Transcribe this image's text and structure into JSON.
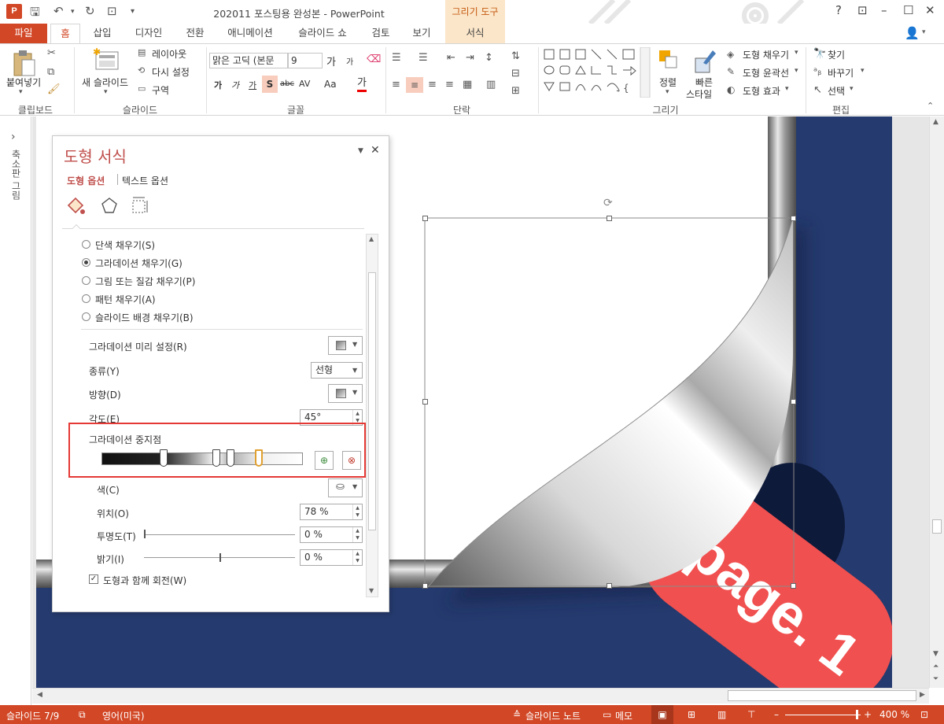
{
  "titlebar": {
    "title": "202011 포스팅용 완성본 - PowerPoint",
    "contextual_group": "그리기 도구",
    "help": "?"
  },
  "tabs": [
    {
      "label": "파일"
    },
    {
      "label": "홈"
    },
    {
      "label": "삽입"
    },
    {
      "label": "디자인"
    },
    {
      "label": "전환"
    },
    {
      "label": "애니메이션"
    },
    {
      "label": "슬라이드 쇼"
    },
    {
      "label": "검토"
    },
    {
      "label": "보기"
    },
    {
      "label": "서식"
    }
  ],
  "ribbon": {
    "clipboard": {
      "paste": "붙여넣기",
      "label": "클립보드"
    },
    "slides": {
      "new_slide": "새 슬라이드",
      "layout": "레이아웃",
      "reset": "다시 설정",
      "section": "구역",
      "label": "슬라이드"
    },
    "font": {
      "font_name": "맑은 고딕 (본문",
      "font_size": "9",
      "label": "글꼴",
      "grow": "가",
      "shrink": "가",
      "bold": "가",
      "italic": "가",
      "underline": "가",
      "shadow": "S",
      "strike": "abc",
      "spacing": "AV",
      "case": "Aa",
      "color": "가"
    },
    "paragraph": {
      "label": "단락"
    },
    "drawing": {
      "arrange": "정렬",
      "quick_styles_1": "빠른",
      "quick_styles_2": "스타일",
      "shape_fill": "도형 채우기",
      "shape_outline": "도형 윤곽선",
      "shape_effects": "도형 효과",
      "label": "그리기"
    },
    "editing": {
      "find": "찾기",
      "replace": "바꾸기",
      "select": "선택",
      "label": "편집"
    }
  },
  "left_strip": {
    "label": "축소판 그림",
    "expand": "›"
  },
  "pane": {
    "title": "도형 서식",
    "tab_shape": "도형 옵션",
    "tab_text": "텍스트 옵션",
    "fill_options": [
      {
        "label": "단색 채우기(S)",
        "selected": false
      },
      {
        "label": "그라데이션 채우기(G)",
        "selected": true
      },
      {
        "label": "그림 또는 질감 채우기(P)",
        "selected": false
      },
      {
        "label": "패턴 채우기(A)",
        "selected": false
      },
      {
        "label": "슬라이드 배경 채우기(B)",
        "selected": false
      }
    ],
    "preset_label": "그라데이션 미리 설정(R)",
    "type_label": "종류(Y)",
    "type_value": "선형",
    "direction_label": "방향(D)",
    "angle_label": "각도(E)",
    "angle_value": "45°",
    "stops_label": "그라데이션 중지점",
    "gradient_stops": [
      0.31,
      0.57,
      0.64,
      0.78
    ],
    "selected_stop": 0.78,
    "color_label": "색(C)",
    "position_label": "위치(O)",
    "position_value": "78 %",
    "transparency_label": "투명도(T)",
    "transparency_value": "0 %",
    "transparency_level": 0,
    "brightness_label": "밝기(I)",
    "brightness_value": "0 %",
    "brightness_level": 0.5,
    "rotate_with_shape": "도형과 함께 회전(W)",
    "rotate_checked": true
  },
  "slide": {
    "tab_text": "page. 1",
    "colors": {
      "navy": "#253a6e",
      "coral": "#f0504f",
      "highlight": "#e53935"
    }
  },
  "status": {
    "slide_info": "슬라이드 7/9",
    "language": "영어(미국)",
    "notes": "슬라이드 노트",
    "comments": "메모",
    "zoom": "400 %"
  }
}
